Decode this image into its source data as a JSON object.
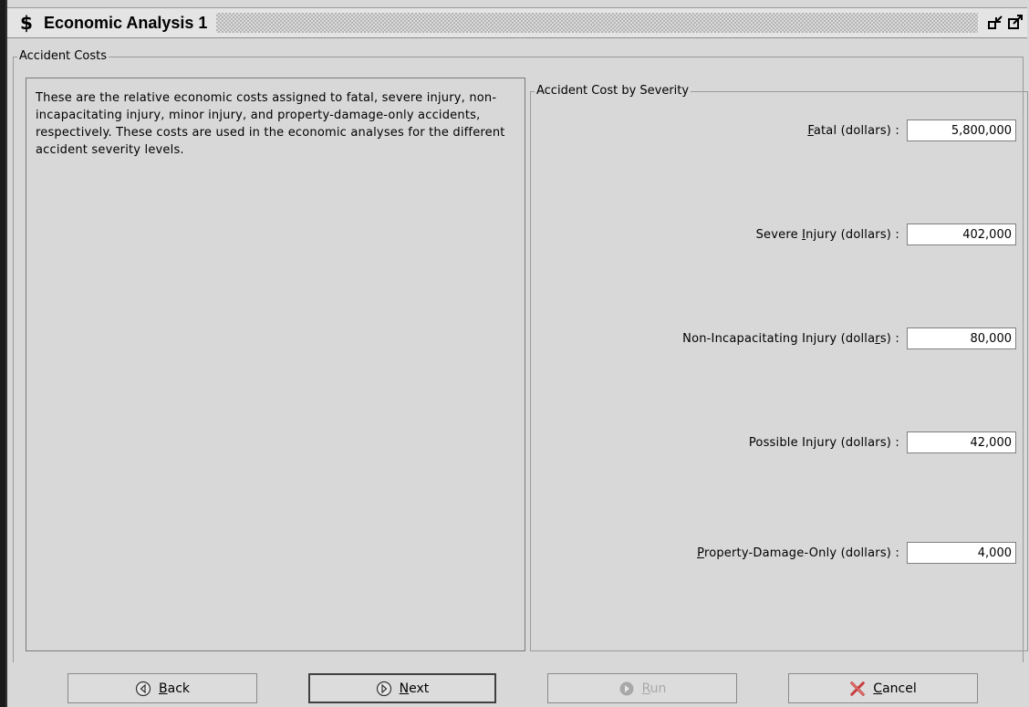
{
  "window": {
    "icon_glyph": "$",
    "title": "Economic Analysis 1",
    "buttons": [
      "restore-icon",
      "maximize-icon"
    ]
  },
  "outer_group": {
    "title": "Accident Costs"
  },
  "description": "These are the relative economic costs assigned to fatal, severe injury, non-incapacitating injury, minor injury, and property-damage-only accidents, respectively. These costs are used in the economic analyses for the different accident severity levels.",
  "cost_group": {
    "title": "Accident Cost by Severity",
    "fields": [
      {
        "label": "Fatal (dollars) :",
        "value": "5,800,000"
      },
      {
        "label": "Severe Injury (dollars) :",
        "value": "402,000"
      },
      {
        "label": "Non-Incapacitating Injury (dollars) :",
        "value": "80,000"
      },
      {
        "label": "Possible Injury (dollars) :",
        "value": "42,000"
      },
      {
        "label": "Property-Damage-Only (dollars) :",
        "value": "4,000"
      }
    ]
  },
  "footer": {
    "back": {
      "label": "Back",
      "icon": "back-arrow-icon",
      "enabled": true
    },
    "next": {
      "label": "Next",
      "icon": "next-arrow-icon",
      "enabled": true
    },
    "run": {
      "label": "Run",
      "icon": "run-icon",
      "enabled": false
    },
    "cancel": {
      "label": "Cancel",
      "icon": "cancel-x-icon",
      "enabled": true
    }
  }
}
